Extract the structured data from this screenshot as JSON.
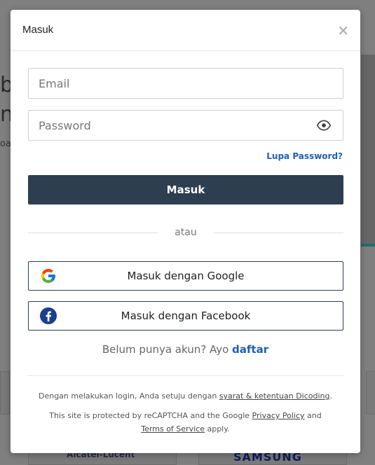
{
  "background": {
    "text_line_1": "b",
    "text_line_2": "n",
    "text_line_3": "oa",
    "logo_1": "Alcatel-Lucent",
    "logo_2": "SAMSUNG"
  },
  "modal": {
    "title": "Masuk",
    "close_symbol": "×",
    "email_placeholder": "Email",
    "password_placeholder": "Password",
    "forgot_password": "Lupa Password?",
    "submit_label": "Masuk",
    "divider_label": "atau",
    "google_label": "Masuk dengan Google",
    "facebook_label": "Masuk dengan Facebook",
    "register_prefix": "Belum punya akun? Ayo",
    "register_link": "daftar",
    "terms_prefix": "Dengan melakukan login, Anda setuju dengan",
    "terms_link": "syarat & ketentuan Dicoding",
    "terms_suffix": ".",
    "recaptcha_prefix": "This site is protected by reCAPTCHA and the Google",
    "privacy_link": "Privacy Policy",
    "recaptcha_and": "and",
    "tos_link": "Terms of Service",
    "recaptcha_suffix": "apply."
  },
  "icons": {
    "eye": "eye-icon",
    "google": "google-icon",
    "facebook": "facebook-icon",
    "close": "close-icon"
  },
  "colors": {
    "primary_button": "#2d3e50",
    "link": "#1f5fb0",
    "overlay": "#808080"
  }
}
